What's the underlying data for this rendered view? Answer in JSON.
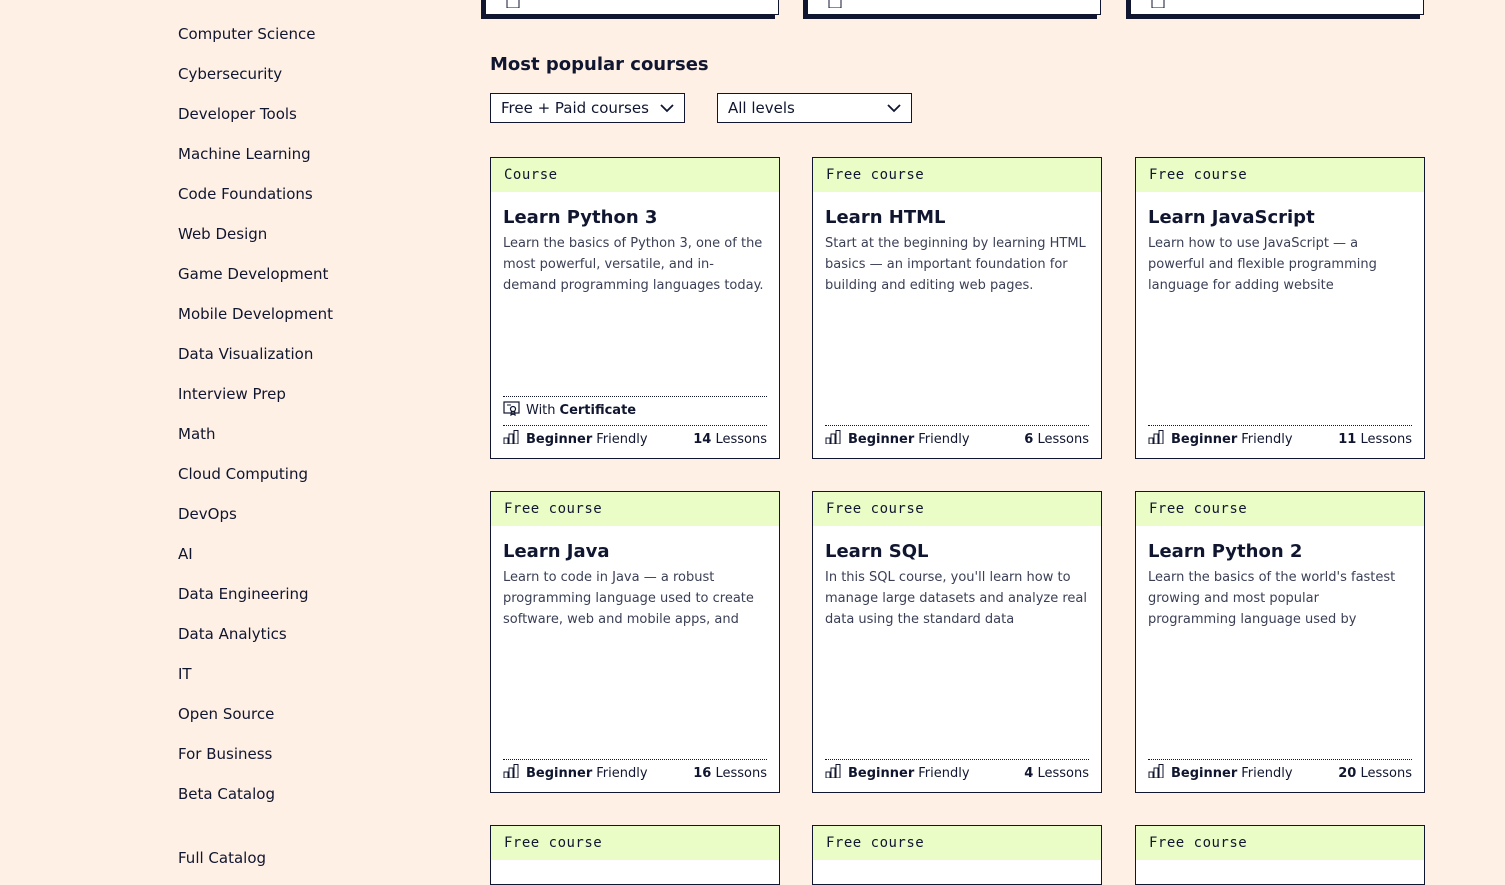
{
  "sidebar": {
    "items": [
      "Computer Science",
      "Cybersecurity",
      "Developer Tools",
      "Machine Learning",
      "Code Foundations",
      "Web Design",
      "Game Development",
      "Mobile Development",
      "Data Visualization",
      "Interview Prep",
      "Math",
      "Cloud Computing",
      "DevOps",
      "AI",
      "Data Engineering",
      "Data Analytics",
      "IT",
      "Open Source",
      "For Business",
      "Beta Catalog"
    ],
    "full_catalog": "Full Catalog"
  },
  "section": {
    "title": "Most popular courses",
    "price_filter": "Free + Paid courses",
    "level_filter": "All levels"
  },
  "labels": {
    "with": "With",
    "certificate": "Certificate",
    "beginner": "Beginner",
    "friendly": "Friendly",
    "lessons": "Lessons"
  },
  "courses": [
    {
      "tag": "Course",
      "title": "Learn Python 3",
      "desc": "Learn the basics of Python 3, one of the most powerful, versatile, and in-demand programming languages today.",
      "lessons": "14",
      "certificate": true
    },
    {
      "tag": "Free course",
      "title": "Learn HTML",
      "desc": "Start at the beginning by learning HTML basics — an important foundation for building and editing web pages.",
      "lessons": "6",
      "certificate": false
    },
    {
      "tag": "Free course",
      "title": "Learn JavaScript",
      "desc": "Learn how to use JavaScript — a powerful and flexible programming language for adding website interactivity.",
      "lessons": "11",
      "certificate": false
    },
    {
      "tag": "Free course",
      "title": "Learn Java",
      "desc": "Learn to code in Java — a robust programming language used to create software, web and mobile apps, and more.",
      "lessons": "16",
      "certificate": false
    },
    {
      "tag": "Free course",
      "title": "Learn SQL",
      "desc": "In this SQL course, you'll learn how to manage large datasets and analyze real data using the standard data managemen…",
      "lessons": "4",
      "certificate": false
    },
    {
      "tag": "Free course",
      "title": "Learn Python 2",
      "desc": "Learn the basics of the world's fastest growing and most popular programming language used by software engineers,…",
      "lessons": "20",
      "certificate": false
    }
  ],
  "more_courses": [
    {
      "tag": "Free course"
    },
    {
      "tag": "Free course"
    },
    {
      "tag": "Free course"
    }
  ]
}
